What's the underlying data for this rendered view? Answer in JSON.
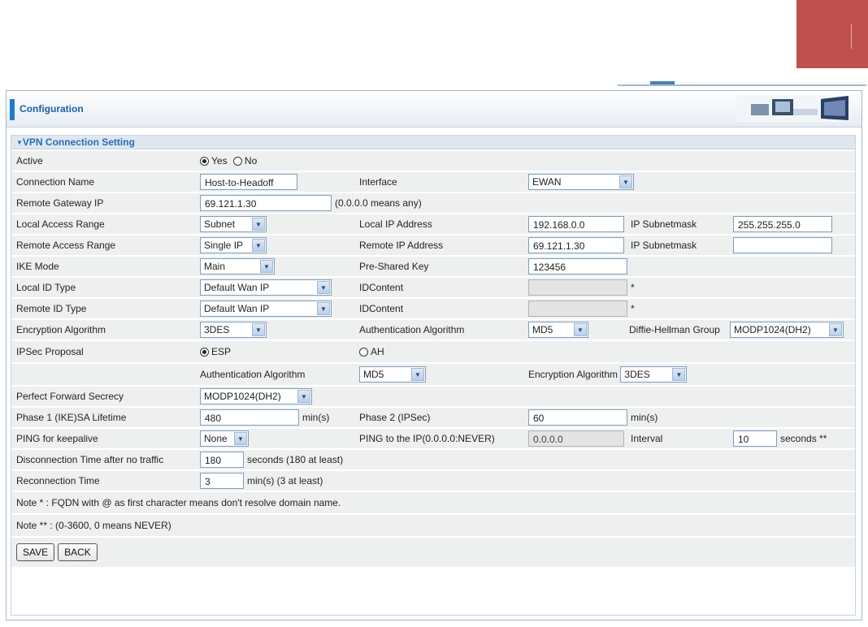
{
  "header": {
    "title": "Configuration"
  },
  "section": {
    "title": "VPN Connection Setting"
  },
  "icons": {
    "dropdown": "chevron-down-icon",
    "radio": "radio-icon",
    "triangle": "triangle-down-icon"
  },
  "colors": {
    "accent": "#1f7ad1",
    "corner": "#c0504d",
    "note": "#3a78c0"
  },
  "active": {
    "label": "Active",
    "yes": "Yes",
    "no": "No",
    "selected": "Yes"
  },
  "connection_name": {
    "label": "Connection Name",
    "value": "Host-to-Headoff"
  },
  "interface": {
    "label": "Interface",
    "value": "EWAN"
  },
  "remote_gateway": {
    "label": "Remote Gateway IP",
    "value": "69.121.1.30",
    "hint": "(0.0.0.0 means any)"
  },
  "local_access": {
    "label": "Local Access Range",
    "value": "Subnet",
    "ip_label": "Local IP Address",
    "ip": "192.168.0.0",
    "mask_label": "IP Subnetmask",
    "mask": "255.255.255.0"
  },
  "remote_access": {
    "label": "Remote Access Range",
    "value": "Single IP",
    "ip_label": "Remote IP Address",
    "ip": "69.121.1.30",
    "mask_label": "IP Subnetmask",
    "mask": ""
  },
  "ike_mode": {
    "label": "IKE Mode",
    "value": "Main",
    "psk_label": "Pre-Shared Key",
    "psk": "123456"
  },
  "local_id": {
    "label": "Local ID Type",
    "value": "Default Wan IP",
    "content_label": "IDContent",
    "content": "",
    "mark": "*"
  },
  "remote_id": {
    "label": "Remote ID Type",
    "value": "Default Wan IP",
    "content_label": "IDContent",
    "content": "",
    "mark": "*"
  },
  "encryption": {
    "label": "Encryption Algorithm",
    "value": "3DES",
    "auth_label": "Authentication Algorithm",
    "auth": "MD5",
    "dh_label": "Diffie-Hellman Group",
    "dh": "MODP1024(DH2)"
  },
  "ipsec": {
    "label": "IPSec Proposal",
    "esp": "ESP",
    "ah": "AH",
    "selected": "ESP",
    "auth_label": "Authentication Algorithm",
    "auth": "MD5",
    "enc_label": "Encryption Algorithm",
    "enc": "3DES"
  },
  "pfs": {
    "label": "Perfect Forward Secrecy",
    "value": "MODP1024(DH2)"
  },
  "phase1": {
    "label": "Phase 1 (IKE)SA Lifetime",
    "value": "480",
    "unit": "min(s)",
    "p2_label": "Phase 2 (IPSec)",
    "p2": "60",
    "p2_unit": "min(s)"
  },
  "ping": {
    "label": "PING for keepalive",
    "value": "None",
    "ip_label": "PING to the IP(0.0.0.0:NEVER)",
    "ip": "0.0.0.0",
    "interval_label": "Interval",
    "interval": "10",
    "interval_unit": "seconds **"
  },
  "disconnect": {
    "label": "Disconnection Time after no traffic",
    "value": "180",
    "unit": "seconds (180 at least)"
  },
  "reconnect": {
    "label": "Reconnection Time",
    "value": "3",
    "unit": "min(s) (3 at least)"
  },
  "notes": {
    "note1": "Note * : FQDN with @ as first character means don't resolve domain name.",
    "note2": "Note ** : (0-3600, 0 means NEVER)"
  },
  "buttons": {
    "save": "SAVE",
    "back": "BACK"
  }
}
